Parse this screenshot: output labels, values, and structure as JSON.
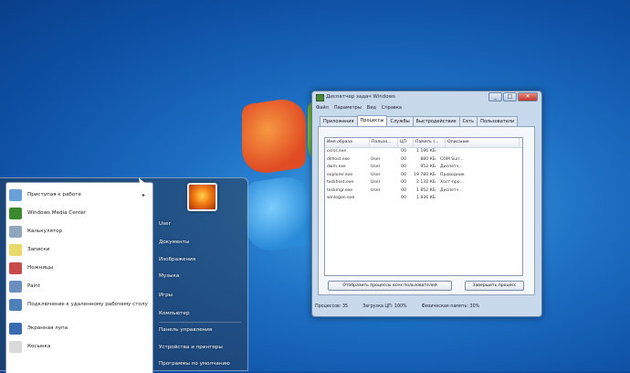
{
  "task_manager": {
    "title": "Диспетчер задач Windows",
    "menu": [
      "Файл",
      "Параметры",
      "Вид",
      "Справка"
    ],
    "window_buttons": [
      "_",
      "□",
      "✕"
    ],
    "tabs": [
      "Приложения",
      "Процессы",
      "Службы",
      "Быстродействие",
      "Сеть",
      "Пользователи"
    ],
    "active_tab": "Процессы",
    "columns": [
      "Имя образа",
      "Пользо...",
      "ЦП",
      "Память (...",
      "Описание"
    ],
    "rows": [
      [
        "csrss.exe",
        "",
        "00",
        "1 196 КБ",
        ""
      ],
      [
        "dllhost.exe",
        "User",
        "00",
        "880 КБ",
        "COM Surr..."
      ],
      [
        "dwm.exe",
        "User",
        "00",
        "952 КБ",
        "Диспетч..."
      ],
      [
        "explorer.exe",
        "User",
        "00",
        "19 780 КБ",
        "Проводник"
      ],
      [
        "taskhost.exe",
        "User",
        "00",
        "2 132 КБ",
        "Хост-про..."
      ],
      [
        "taskmgr.exe",
        "User",
        "00",
        "1 852 КБ",
        "Диспетч..."
      ],
      [
        "winlogon.exe",
        "",
        "00",
        "1 836 КБ",
        ""
      ]
    ],
    "show_all_label": "Отобразить процессы всех пользователей",
    "end_process_label": "Завершить процесс",
    "status": {
      "processes": "Процессов: 35",
      "cpu": "Загрузка ЦП: 100%",
      "memory": "Физическая память: 30%"
    }
  },
  "start_menu": {
    "left_items": [
      {
        "label": "Приступая к работе",
        "icon": "getting-started-icon",
        "color": "#6aa0d8",
        "arrow": true
      },
      {
        "label": "Windows Media Center",
        "icon": "media-center-icon",
        "color": "#3c8a2e",
        "arrow": false
      },
      {
        "label": "Калькулятор",
        "icon": "calculator-icon",
        "color": "#8fa6bd",
        "arrow": false
      },
      {
        "label": "Записки",
        "icon": "sticky-notes-icon",
        "color": "#e8d96a",
        "arrow": false
      },
      {
        "label": "Ножницы",
        "icon": "scissors-icon",
        "color": "#c94a4a",
        "arrow": false
      },
      {
        "label": "Paint",
        "icon": "paint-icon",
        "color": "#6b8fbf",
        "arrow": false
      },
      {
        "label": "Подключение к удаленному рабочему столу",
        "icon": "remote-desktop-icon",
        "color": "#4f7fb8",
        "arrow": false
      },
      {
        "label": "Экранная лупа",
        "icon": "magnifier-icon",
        "color": "#3a6bb0",
        "arrow": false
      },
      {
        "label": "Косынка",
        "icon": "solitaire-icon",
        "color": "#d9d9d9",
        "arrow": false
      }
    ],
    "right_items": [
      "User",
      "Документы",
      "Изображения",
      "Музыка",
      "Игры",
      "Компьютер",
      "Панель управления",
      "Устройства и принтеры",
      "Программы по умолчанию"
    ]
  }
}
